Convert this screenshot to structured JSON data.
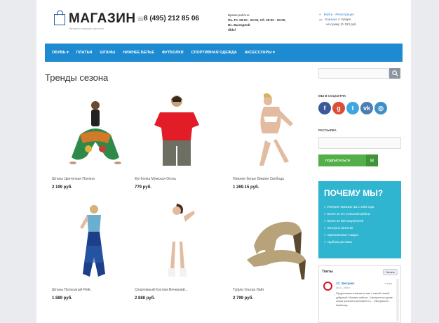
{
  "header": {
    "logo_title": "МАГАЗИН",
    "logo_subtitle": "Интернет магазин женской",
    "phone": "8 (495) 212 85 06",
    "hours_label": "Время работы:",
    "hours_weekdays": "Пн.-Пт. 09:00 - 20:00, Сб. 09:00 - 20:00,",
    "hours_sunday": "Вс. Выходной",
    "hours_extra": "dfdsf",
    "login_link": "Войти",
    "register_link": "Регистрация",
    "cart_link": "Корзина",
    "cart_count": "4 товара",
    "cart_total": "на сумму 11 153 руб."
  },
  "nav": [
    "ОБУВЬ ▾",
    "ПЛАТЬЯ",
    "ШТАНЫ",
    "НИЖНЕЕ БЕЛЬЕ",
    "ФУТБОЛКИ",
    "СПОРТИВНАЯ ОДЕЖДА",
    "АКСЕССУАРЫ ▾"
  ],
  "main": {
    "heading": "Тренды сезона",
    "products": [
      {
        "name": "Штаны Цветочная Поляна",
        "price": "2 199 руб."
      },
      {
        "name": "Футболка Мужская Огонь",
        "price": "779 руб."
      },
      {
        "name": "Нижнее белье Бикини Свобода",
        "price": "1 269.15 руб."
      },
      {
        "name": "Штаны Полосатый Рейс",
        "price": "1 889 руб."
      },
      {
        "name": "Спортивный Костюм Вечерний...",
        "price": "2 888 руб."
      },
      {
        "name": "Туфли Ультра Лайт",
        "price": "2 799 руб."
      }
    ]
  },
  "sidebar": {
    "social_title": "МЫ В СОЦСЕТЯХ",
    "social_icons": [
      "facebook-icon",
      "google-plus-icon",
      "twitter-icon",
      "vk-icon",
      "instagram-icon"
    ],
    "newsletter_title": "РАССЫЛКА",
    "subscribe_label": "ПОДПИСАТЬСЯ",
    "why_title": "ПОЧЕМУ МЫ?",
    "why_items": [
      "Интернет-магазин №1 с 2008 года",
      "Более 10 лет успешной работы",
      "Более 20 000 покупателей",
      "Контроль качества",
      "Оригинальные товары",
      "Удобная доставка"
    ],
    "tweets_title": "Твиты",
    "tweets_follow": "Читать",
    "tweet_user": "1С_Битрикс",
    "tweet_handle": "@1C_Bitrix",
    "tweet_date": "6 мая",
    "tweet_text": "Продолжаем знакомить вас с нашей новой рубрикой «Бизнес-кейсы». Смотрите в группе серия youtube.com/watch?v=... #Битрикс24 #вебинар"
  },
  "colors": {
    "nav": "#1d8ad2",
    "subscribe": "#53b048",
    "why_box": "#2fb5cf"
  }
}
